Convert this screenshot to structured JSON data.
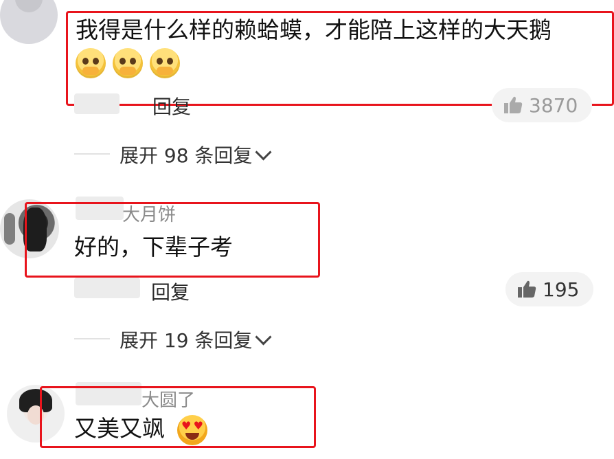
{
  "comments": [
    {
      "username": "",
      "text": "我得是什么样的赖蛤蟆，才能陪上这样的大天鹅",
      "emojis": [
        "pleading-emoji",
        "pleading-emoji",
        "pleading-emoji"
      ],
      "reply_label": "回复",
      "like_count": "3870",
      "expand_text": "展开 98 条回复"
    },
    {
      "username": "大月饼",
      "text": "好的，下辈子考",
      "reply_label": "回复",
      "like_count": "195",
      "expand_text": "展开 19 条回复"
    },
    {
      "username": "大圆了",
      "text": "又美又飒",
      "emojis": [
        "heart-eyes-emoji"
      ]
    }
  ],
  "colors": {
    "highlight_box": "#e8141c",
    "text": "#111111",
    "muted": "#8a8a8a",
    "like_pill": "#f3f3f3"
  },
  "icons": {
    "like": "thumbs-up-icon",
    "expand": "chevron-down-icon"
  }
}
